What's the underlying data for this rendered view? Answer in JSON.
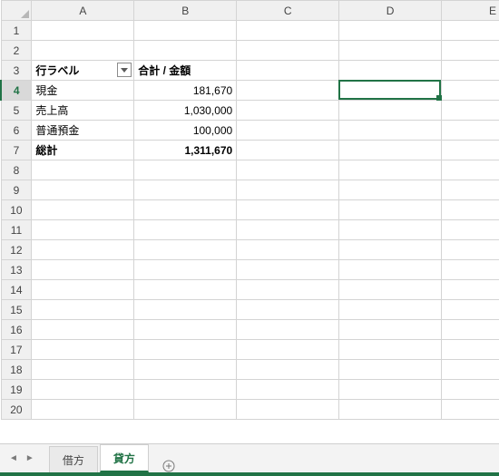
{
  "columns": [
    "A",
    "B",
    "C",
    "D",
    "E"
  ],
  "rowCount": 20,
  "activeRow": 4,
  "selectedCell": "D4",
  "pivot": {
    "headerRow": 3,
    "rowLabelHeader": "行ラベル",
    "valueHeader": "合計 / 金額",
    "rows": [
      {
        "label": "現金",
        "value": "181,670"
      },
      {
        "label": "売上高",
        "value": "1,030,000"
      },
      {
        "label": "普通預金",
        "value": "100,000"
      }
    ],
    "totalLabel": "総計",
    "totalValue": "1,311,670"
  },
  "tabs": {
    "items": [
      {
        "label": "借方",
        "active": false
      },
      {
        "label": "貸方",
        "active": true
      }
    ]
  },
  "chart_data": {
    "type": "table",
    "title": "合計 / 金額",
    "categories": [
      "現金",
      "売上高",
      "普通預金"
    ],
    "values": [
      181670,
      1030000,
      100000
    ],
    "total": 1311670
  }
}
